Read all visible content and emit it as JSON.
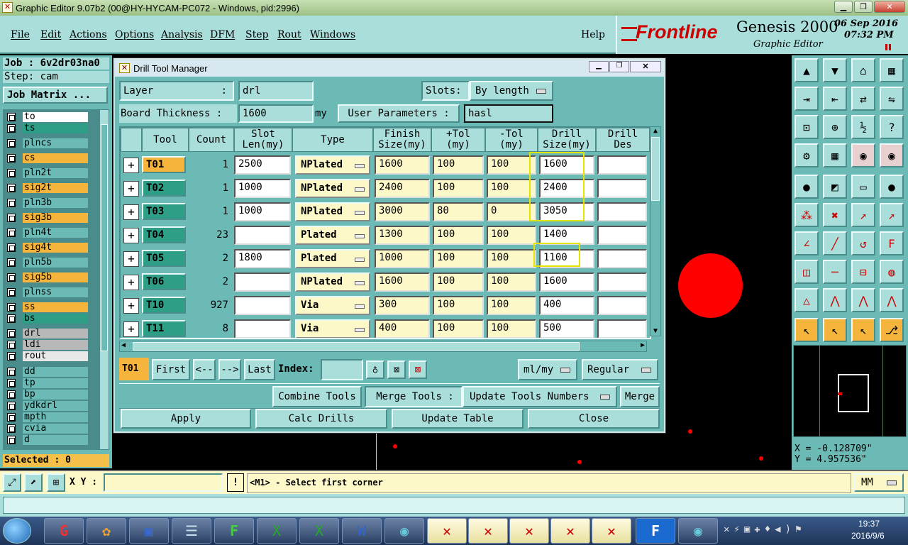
{
  "window": {
    "title": "Graphic Editor 9.07b2 (00@HY-HYCAM-PC072 - Windows, pid:2996)"
  },
  "menu": {
    "items": [
      "File",
      "Edit",
      "Actions",
      "Options",
      "Analysis",
      "DFM",
      "Step",
      "Rout",
      "Windows"
    ],
    "help": "Help"
  },
  "brand": {
    "logo": "Frontline",
    "product": "Genesis 2000",
    "subtitle": "Graphic Editor",
    "date": "06 Sep 2016",
    "time": "07:32 PM"
  },
  "left": {
    "job": "Job : 6v2dr03na0",
    "step": "Step: cam",
    "job_matrix": "Job Matrix ...",
    "layers": [
      {
        "name": "to",
        "color": "#ffffff"
      },
      {
        "name": "ts",
        "color": "#2e9e86"
      },
      {
        "name": "plncs",
        "color": "#6cbab6"
      },
      {
        "name": "cs",
        "color": "#f5b43c"
      },
      {
        "name": "pln2t",
        "color": "#6cbab6"
      },
      {
        "name": "sig2t",
        "color": "#f5b43c"
      },
      {
        "name": "pln3b",
        "color": "#6cbab6"
      },
      {
        "name": "sig3b",
        "color": "#f5b43c"
      },
      {
        "name": "pln4t",
        "color": "#6cbab6"
      },
      {
        "name": "sig4t",
        "color": "#f5b43c"
      },
      {
        "name": "pln5b",
        "color": "#6cbab6"
      },
      {
        "name": "sig5b",
        "color": "#f5b43c"
      },
      {
        "name": "plnss",
        "color": "#6cbab6"
      },
      {
        "name": "ss",
        "color": "#f5b43c"
      },
      {
        "name": "bs",
        "color": "#2e9e86"
      },
      {
        "name": "drl",
        "color": "#b8b8b8"
      },
      {
        "name": "ldi",
        "color": "#b8b8b8"
      },
      {
        "name": "rout",
        "color": "#e8e8e8"
      },
      {
        "name": "dd",
        "color": "#6cbab6"
      },
      {
        "name": "tp",
        "color": "#6cbab6"
      },
      {
        "name": "bp",
        "color": "#6cbab6"
      },
      {
        "name": "ydkdrl",
        "color": "#6cbab6"
      },
      {
        "name": "mpth",
        "color": "#6cbab6"
      },
      {
        "name": "cvia",
        "color": "#6cbab6"
      },
      {
        "name": "d",
        "color": "#6cbab6"
      }
    ],
    "selected": "Selected : 0"
  },
  "dialog": {
    "title": "Drill Tool Manager",
    "layer_label": "Layer",
    "layer_colon": ":",
    "layer_value": "drl",
    "slots_label": "Slots:",
    "slots_value": "By length",
    "board_thickness_label": "Board Thickness :",
    "board_thickness_value": "1600",
    "board_thickness_unit": "my",
    "user_params_label": "User Parameters :",
    "user_params_value": "hasl",
    "columns": [
      "Tool",
      "Count",
      "Slot Len(my)",
      "Type",
      "Finish Size(my)",
      "+Tol (my)",
      "-Tol (my)",
      "Drill Size(my)",
      "Drill Des"
    ],
    "rows": [
      {
        "tool": "T01",
        "count": "1",
        "slot": "2500",
        "type": "NPlated",
        "finish": "1600",
        "ptol": "100",
        "mtol": "100",
        "drill": "1600",
        "des": ""
      },
      {
        "tool": "T02",
        "count": "1",
        "slot": "1000",
        "type": "NPlated",
        "finish": "2400",
        "ptol": "100",
        "mtol": "100",
        "drill": "2400",
        "des": ""
      },
      {
        "tool": "T03",
        "count": "1",
        "slot": "1000",
        "type": "NPlated",
        "finish": "3000",
        "ptol": "80",
        "mtol": "0",
        "drill": "3050",
        "des": ""
      },
      {
        "tool": "T04",
        "count": "23",
        "slot": "",
        "type": "Plated",
        "finish": "1300",
        "ptol": "100",
        "mtol": "100",
        "drill": "1400",
        "des": ""
      },
      {
        "tool": "T05",
        "count": "2",
        "slot": "1800",
        "type": "Plated",
        "finish": "1000",
        "ptol": "100",
        "mtol": "100",
        "drill": "1100",
        "des": ""
      },
      {
        "tool": "T06",
        "count": "2",
        "slot": "",
        "type": "NPlated",
        "finish": "1600",
        "ptol": "100",
        "mtol": "100",
        "drill": "1600",
        "des": ""
      },
      {
        "tool": "T10",
        "count": "927",
        "slot": "",
        "type": "Via",
        "finish": "300",
        "ptol": "100",
        "mtol": "100",
        "drill": "400",
        "des": ""
      },
      {
        "tool": "T11",
        "count": "8",
        "slot": "",
        "type": "Via",
        "finish": "400",
        "ptol": "100",
        "mtol": "100",
        "drill": "500",
        "des": ""
      }
    ],
    "nav": {
      "current": "T01",
      "first": "First",
      "prev": "<--",
      "next": "-->",
      "last": "Last",
      "index_label": "Index:",
      "units": "ml/my",
      "mode": "Regular"
    },
    "actions": {
      "combine": "Combine Tools",
      "merge_tools": "Merge Tools :",
      "update_numbers": "Update Tools Numbers",
      "merge": "Merge"
    },
    "bottom": {
      "apply": "Apply",
      "calc": "Calc Drills",
      "update": "Update Table",
      "close": "Close"
    }
  },
  "coords": {
    "x": "X = -0.128709\"",
    "y": "Y = 4.957536\""
  },
  "status": {
    "xy_label": "X Y :",
    "prompt": "<M1> - Select first corner",
    "units": "MM"
  },
  "clock": {
    "time": "19:37",
    "date": "2016/9/6"
  }
}
